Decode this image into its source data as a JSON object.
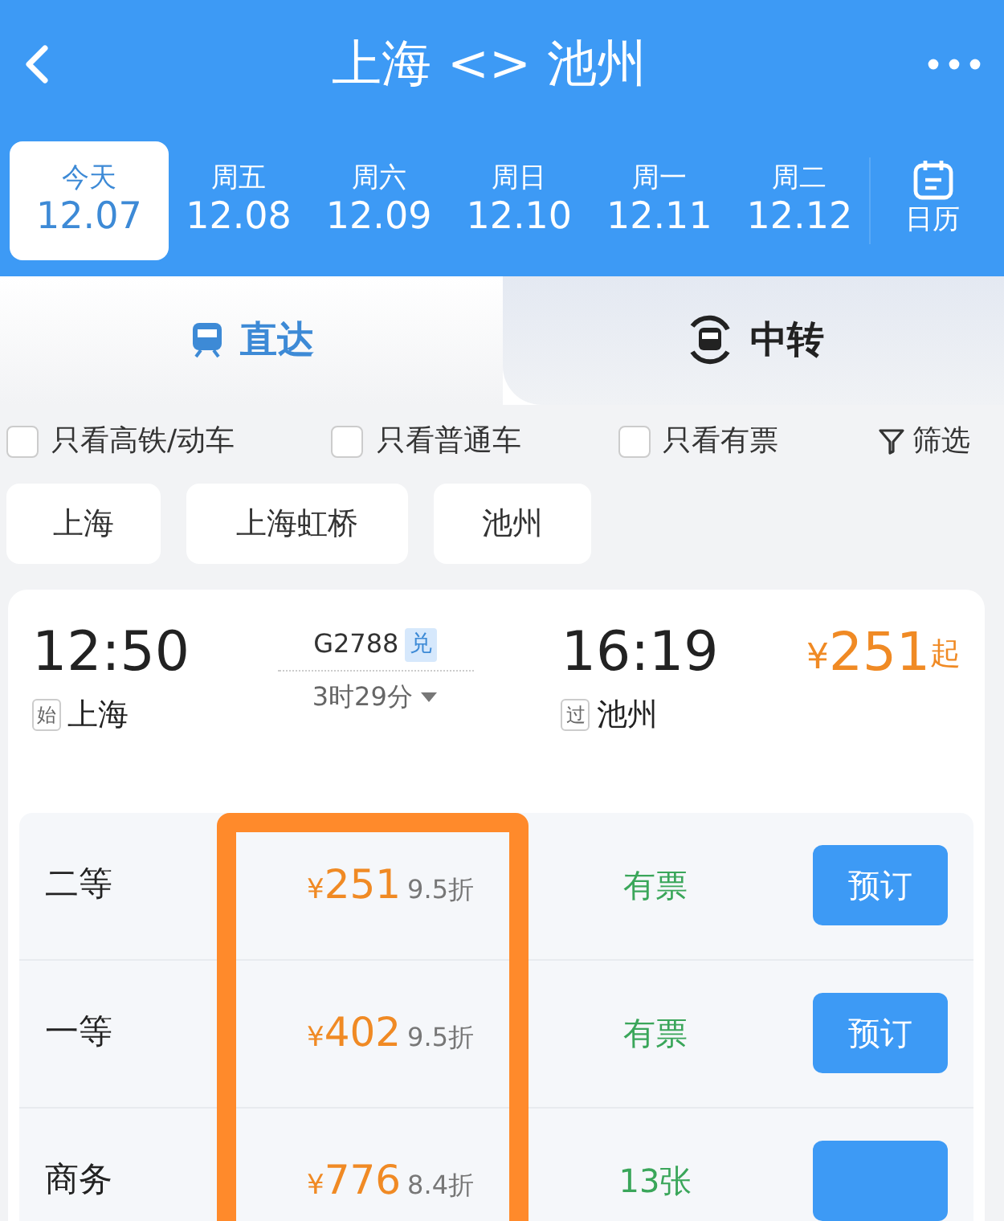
{
  "title": "上海 <> 池州",
  "dates": [
    {
      "weekday": "今天",
      "date": "12.07",
      "selected": true
    },
    {
      "weekday": "周五",
      "date": "12.08",
      "selected": false
    },
    {
      "weekday": "周六",
      "date": "12.09",
      "selected": false
    },
    {
      "weekday": "周日",
      "date": "12.10",
      "selected": false
    },
    {
      "weekday": "周一",
      "date": "12.11",
      "selected": false
    },
    {
      "weekday": "周二",
      "date": "12.12",
      "selected": false
    }
  ],
  "calendar": "日历",
  "tabs": [
    {
      "label": "直达",
      "selected": true,
      "kind": "direct"
    },
    {
      "label": "中转",
      "selected": false,
      "kind": "transfer"
    }
  ],
  "filters": [
    {
      "label": "只看高铁/动车",
      "kind": "checkbox",
      "checked": false
    },
    {
      "label": "只看普通车",
      "kind": "checkbox",
      "checked": false
    },
    {
      "label": "只看有票",
      "kind": "checkbox",
      "checked": false
    },
    {
      "label": "筛选",
      "kind": "filter"
    }
  ],
  "stations": [
    "上海",
    "上海虹桥",
    "池州"
  ],
  "train": {
    "depart_time": "12:50",
    "depart_tag": "始",
    "depart_station": "上海",
    "train_no": "G2788",
    "train_tag": "兑",
    "duration": "3时29分",
    "arrive_time": "16:19",
    "arrive_tag": "过",
    "arrive_station": "池州",
    "currency": "¥",
    "price": "251",
    "price_suffix": "起"
  },
  "seats": [
    {
      "class": "二等",
      "currency": "¥",
      "price": "251",
      "discount": "9.5折",
      "availability": "有票",
      "bookable": true,
      "button": "预订"
    },
    {
      "class": "一等",
      "currency": "¥",
      "price": "402",
      "discount": "9.5折",
      "availability": "有票",
      "bookable": true,
      "button": "预订"
    },
    {
      "class": "商务",
      "currency": "¥",
      "price": "776",
      "discount": "8.4折",
      "availability": "13张",
      "bookable": true
    }
  ]
}
